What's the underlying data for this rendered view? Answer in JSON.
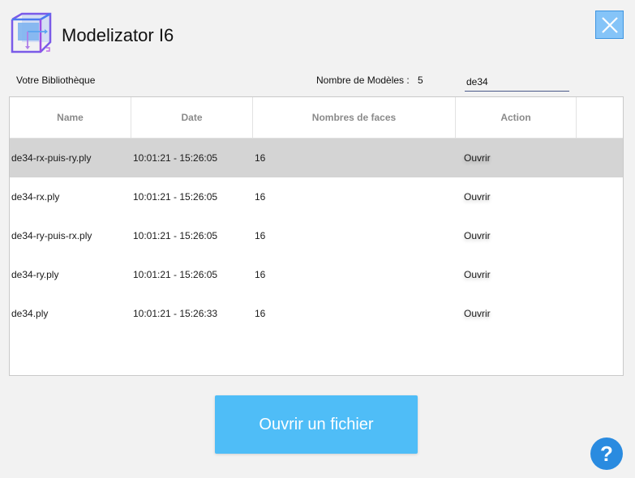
{
  "app": {
    "title": "Modelizator I6",
    "logo_icon": "3d-cube-icon",
    "close_icon": "close-icon"
  },
  "library": {
    "label": "Votre Bibliothèque",
    "count_label": "Nombre de Modèles :",
    "count_value": "5"
  },
  "search": {
    "value": "de34"
  },
  "table": {
    "columns": [
      "Name",
      "Date",
      "Nombres de faces",
      "Action"
    ],
    "rows": [
      {
        "name": "de34-rx-puis-ry.ply",
        "date": "10:01:21 - 15:26:05",
        "faces": "16",
        "action": "Ouvrir",
        "selected": true
      },
      {
        "name": "de34-rx.ply",
        "date": "10:01:21 - 15:26:05",
        "faces": "16",
        "action": "Ouvrir",
        "selected": false
      },
      {
        "name": "de34-ry-puis-rx.ply",
        "date": "10:01:21 - 15:26:05",
        "faces": "16",
        "action": "Ouvrir",
        "selected": false
      },
      {
        "name": "de34-ry.ply",
        "date": "10:01:21 - 15:26:05",
        "faces": "16",
        "action": "Ouvrir",
        "selected": false
      },
      {
        "name": "de34.ply",
        "date": "10:01:21 - 15:26:33",
        "faces": "16",
        "action": "Ouvrir",
        "selected": false
      }
    ]
  },
  "footer": {
    "open_file_label": "Ouvrir un fichier",
    "help_label": "?",
    "help_icon": "help-icon"
  },
  "colors": {
    "accent": "#4fbdf7",
    "help": "#2a8be0",
    "close_bg": "#85c4f8",
    "selected_row": "#d4d4d4"
  }
}
